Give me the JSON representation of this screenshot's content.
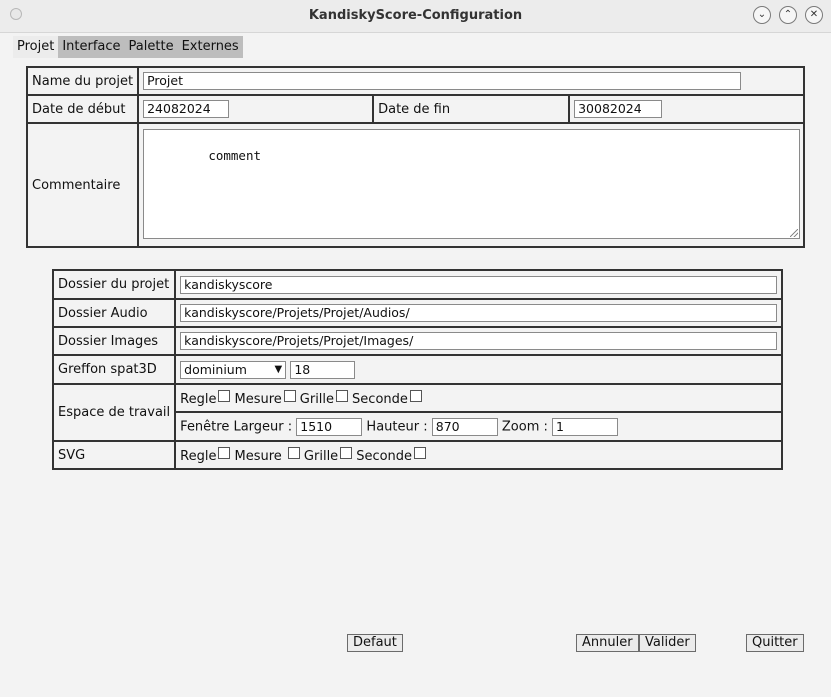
{
  "window": {
    "title": "KandiskyScore-Configuration"
  },
  "menu": {
    "tabs": [
      "Projet",
      "Interface",
      "Palette",
      "Externes"
    ]
  },
  "project": {
    "name_label": "Name du projet",
    "name_value": "Projet",
    "start_label": "Date de début",
    "start_value": "24082024",
    "end_label": "Date de fin",
    "end_value": "30082024",
    "comment_label": "Commentaire",
    "comment_value": "comment"
  },
  "folders": {
    "project_label": "Dossier du projet",
    "project_value": "kandiskyscore",
    "audio_label": "Dossier Audio",
    "audio_value": "kandiskyscore/Projets/Projet/Audios/",
    "images_label": "Dossier Images",
    "images_value": "kandiskyscore/Projets/Projet/Images/",
    "plugin_label": "Greffon spat3D",
    "plugin_selected": "dominium",
    "plugin_number": "18",
    "workspace_label": "Espace de travail",
    "workspace_options": [
      "Regle",
      "Mesure",
      "Grille",
      "Seconde"
    ],
    "window_width_label": "Fenêtre Largeur :",
    "window_width_value": "1510",
    "height_label": "Hauteur :",
    "height_value": "870",
    "zoom_label": "Zoom :",
    "zoom_value": "1",
    "svg_label": "SVG",
    "svg_options": [
      "Regle",
      "Mesure",
      "Grille",
      "Seconde"
    ]
  },
  "buttons": {
    "default": "Defaut",
    "cancel": "Annuler",
    "validate": "Valider",
    "quit": "Quitter"
  }
}
